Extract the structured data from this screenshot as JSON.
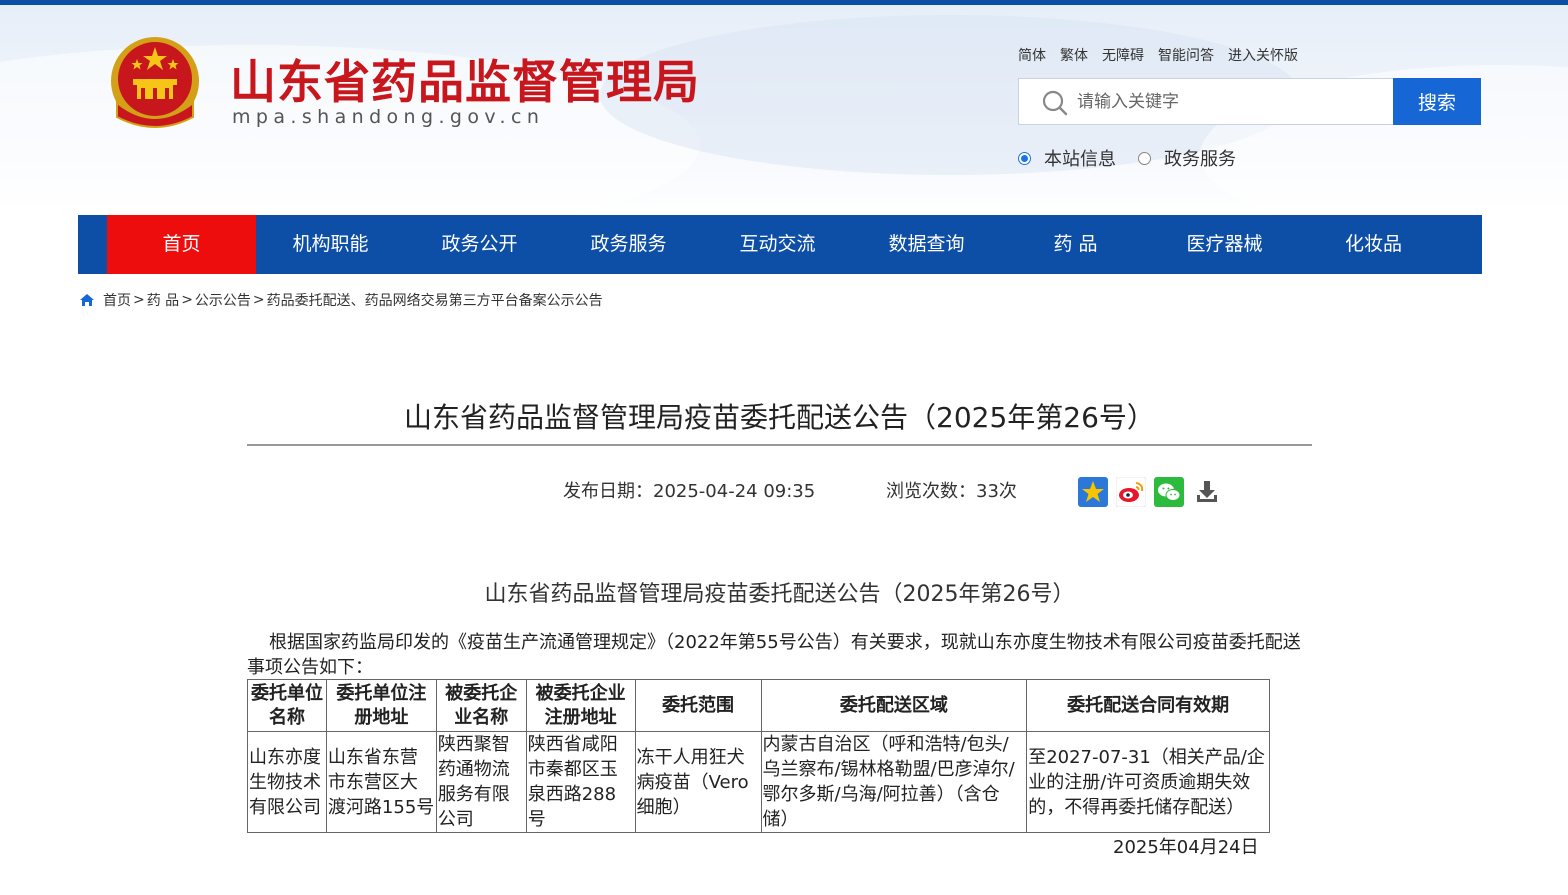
{
  "header": {
    "site_title": "山东省药品监督管理局",
    "site_domain": "mpa.shandong.gov.cn",
    "top_links": [
      "简体",
      "繁体",
      "无障碍",
      "智能问答",
      "进入关怀版"
    ],
    "search": {
      "placeholder": "请输入关键字",
      "button_label": "搜索",
      "scope_options": [
        "本站信息",
        "政务服务"
      ],
      "selected_scope": "本站信息"
    }
  },
  "nav": {
    "items": [
      "首页",
      "机构职能",
      "政务公开",
      "政务服务",
      "互动交流",
      "数据查询",
      "药 品",
      "医疗器械",
      "化妆品"
    ],
    "active": "首页"
  },
  "breadcrumb": [
    "首页",
    "药 品",
    "公示公告",
    "药品委托配送、药品网络交易第三方平台备案公示公告"
  ],
  "article": {
    "title": "山东省药品监督管理局疫苗委托配送公告（2025年第26号）",
    "publish_label": "发布日期：",
    "publish_date": "2025-04-24 09:35",
    "views_label": "浏览次数：",
    "views": "33次",
    "sub_title": "山东省药品监督管理局疫苗委托配送公告（2025年第26号）",
    "paragraph": "根据国家药监局印发的《疫苗生产流通管理规定》（2022年第55号公告）有关要求，现就山东亦度生物技术有限公司疫苗委托配送事项公告如下：",
    "table": {
      "headers": [
        "委托单位名称",
        "委托单位注册地址",
        "被委托企业名称",
        "被委托企业注册地址",
        "委托范围",
        "委托配送区域",
        "委托配送合同有效期"
      ],
      "rows": [
        [
          "山东亦度生物技术有限公司",
          "山东省东营市东营区大渡河路155号",
          "陕西聚智药通物流服务有限公司",
          "陕西省咸阳市秦都区玉泉西路288号",
          "冻干人用狂犬病疫苗（Vero细胞）",
          "内蒙古自治区（呼和浩特/包头/乌兰察布/锡林格勒盟/巴彦淖尔/鄂尔多斯/乌海/阿拉善）（含仓储）",
          "至2027-07-31（相关产品/企业的注册/许可资质逾期失效的，不得再委托储存配送）"
        ]
      ]
    },
    "sign_date": "2025年04月24日"
  },
  "colors": {
    "brand_red": "#c8161d",
    "nav_blue": "#0d4ea6",
    "nav_active_red": "#ee0d0d",
    "search_blue": "#1766d6"
  }
}
